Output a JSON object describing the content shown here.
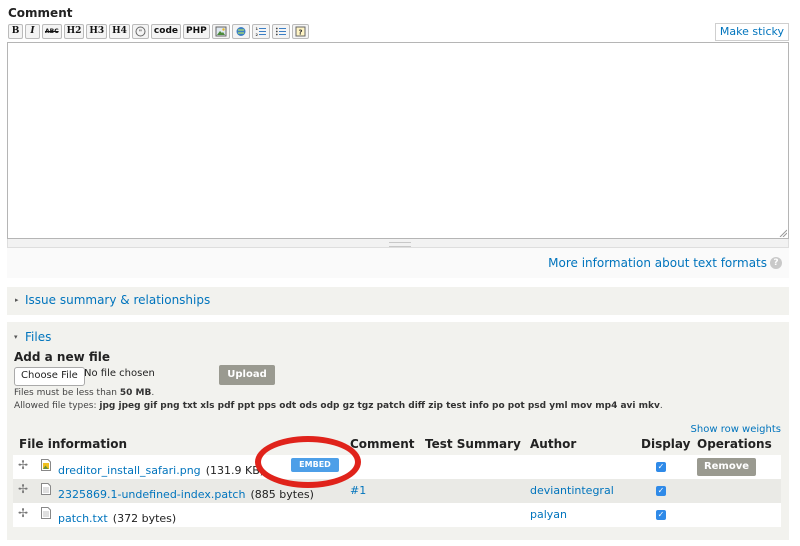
{
  "comment": {
    "label": "Comment",
    "make_sticky": "Make sticky",
    "toolbar": {
      "bold": "B",
      "italic": "I",
      "strike": "ABC",
      "h2": "H2",
      "h3": "H3",
      "h4": "H4",
      "quote_icon": "quote-icon",
      "code": "code",
      "php": "PHP",
      "image_icon": "image-icon",
      "link_icon": "link-icon",
      "ordered_list_icon": "ordered-list-icon",
      "unordered_list_icon": "bullet-list-icon",
      "help_icon": "help-icon"
    },
    "textarea_value": "",
    "more_info": "More information about text formats",
    "help_glyph": "?"
  },
  "issue_summary": {
    "label": "Issue summary & relationships",
    "arrow": "▸"
  },
  "files": {
    "label": "Files",
    "arrow": "▾",
    "add_new_file": "Add a new file",
    "choose_file": "Choose File",
    "no_file": "No file chosen",
    "upload": "Upload",
    "size_limit_prefix": "Files must be less than ",
    "size_limit_value": "50 MB",
    "size_limit_suffix": ".",
    "allowed_prefix": "Allowed file types: ",
    "allowed_types": "jpg jpeg gif png txt xls pdf ppt pps odt ods odp gz tgz patch diff zip test info po pot psd yml mov mp4 avi mkv",
    "allowed_suffix": ".",
    "show_row_weights": "Show row weights",
    "columns": {
      "file_information": "File information",
      "comment": "Comment",
      "test_summary": "Test Summary",
      "author": "Author",
      "display": "Display",
      "operations": "Operations"
    },
    "rows": [
      {
        "name": "dreditor_install_safari.png",
        "size": "(131.9 KB)",
        "comment": "",
        "author": "",
        "display": true,
        "embed": "EMBED",
        "operation": "Remove"
      },
      {
        "name": "2325869.1-undefined-index.patch",
        "size": "(885 bytes)",
        "comment": "#1",
        "author": "deviantintegral",
        "display": true
      },
      {
        "name": "patch.txt",
        "size": "(372 bytes)",
        "comment": "",
        "author": "palyan",
        "display": true
      }
    ],
    "check_glyph": "✓",
    "move_glyph": "✢"
  },
  "colors": {
    "link": "#0074bd",
    "annotation": "#e0231b",
    "embed": "#4d9fe8",
    "checkbox": "#2f8ae8"
  }
}
